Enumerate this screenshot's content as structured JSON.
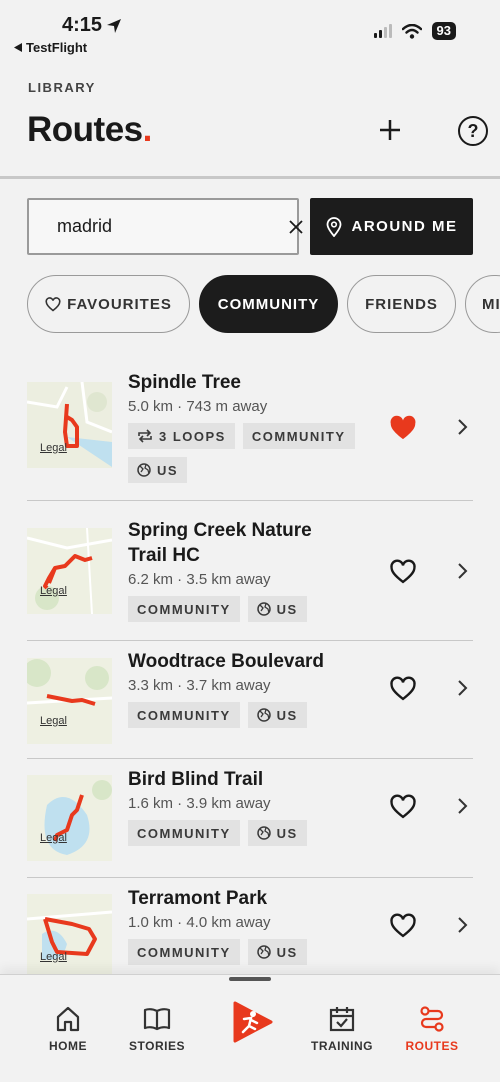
{
  "status_bar": {
    "time": "4:15",
    "back_app": "TestFlight",
    "battery": "93"
  },
  "header": {
    "section_label": "LIBRARY",
    "title": "Routes",
    "title_dot": "."
  },
  "search": {
    "value": "madrid",
    "around_me_label": "AROUND ME"
  },
  "filters": [
    {
      "label": "FAVOURITES",
      "active": false
    },
    {
      "label": "COMMUNITY",
      "active": true
    },
    {
      "label": "FRIENDS",
      "active": false
    },
    {
      "label": "MI",
      "active": false
    }
  ],
  "routes": [
    {
      "name": "Spindle Tree",
      "distance": "5.0 km · 743 m away",
      "tags": [
        "3 LOOPS",
        "COMMUNITY",
        "US"
      ],
      "favourite": true,
      "map_legal": "Legal"
    },
    {
      "name": "Spring Creek Nature Trail HC",
      "distance": "6.2 km · 3.5 km away",
      "tags": [
        "COMMUNITY",
        "US"
      ],
      "favourite": false,
      "map_legal": "Legal"
    },
    {
      "name": "Woodtrace Boulevard",
      "distance": "3.3 km · 3.7 km away",
      "tags": [
        "COMMUNITY",
        "US"
      ],
      "favourite": false,
      "map_legal": "Legal"
    },
    {
      "name": "Bird Blind Trail",
      "distance": "1.6 km · 3.9 km away",
      "tags": [
        "COMMUNITY",
        "US"
      ],
      "favourite": false,
      "map_legal": "Legal"
    },
    {
      "name": "Terramont Park",
      "distance": "1.0 km · 4.0 km away",
      "tags": [
        "COMMUNITY",
        "US"
      ],
      "favourite": false,
      "map_legal": "Legal"
    }
  ],
  "nav": {
    "home": "HOME",
    "stories": "STORIES",
    "training": "TRAINING",
    "routes": "ROUTES"
  },
  "colors": {
    "accent": "#e8391d",
    "dark": "#1c1c1c"
  }
}
